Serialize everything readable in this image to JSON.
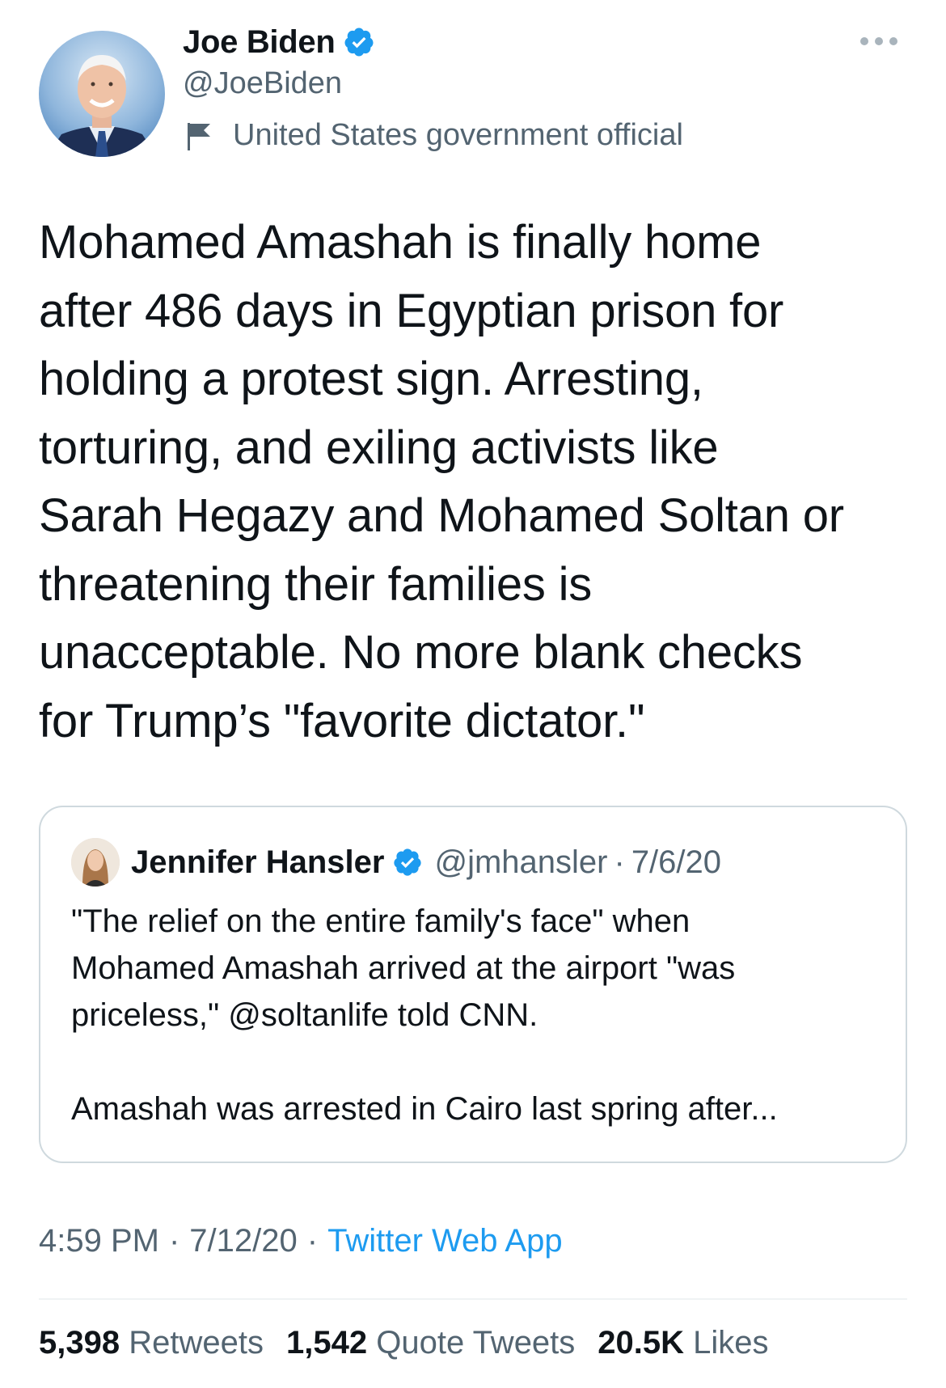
{
  "author": {
    "display_name": "Joe Biden",
    "handle": "@JoeBiden",
    "label": "United States government official",
    "verified": true
  },
  "tweet": {
    "text": "Mohamed Amashah is finally home\nafter 486 days in Egyptian prison for\nholding a protest sign. Arresting,\ntorturing, and exiling activists like\nSarah Hegazy and Mohamed Soltan or\nthreatening their families is\nunacceptable. No more blank checks\nfor Trump’s \"favorite dictator.\""
  },
  "quote": {
    "display_name": "Jennifer Hansler",
    "handle": "@jmhansler",
    "separator": "·",
    "date": "7/6/20",
    "verified": true,
    "text": "\"The relief on the entire family's face\" when\nMohamed Amashah arrived at the airport \"was\npriceless,\" @soltanlife told CNN.\n\nAmashah was arrested in Cairo last spring after..."
  },
  "meta": {
    "time": "4:59 PM",
    "separator": "·",
    "date": "7/12/20",
    "source": "Twitter Web App"
  },
  "stats": {
    "retweets_count": "5,398",
    "retweets_label": "Retweets",
    "quote_tweets_count": "1,542",
    "quote_tweets_label": "Quote Tweets",
    "likes_count": "20.5K",
    "likes_label": "Likes"
  },
  "colors": {
    "verified_blue": "#1d9bf0",
    "text_primary": "#0f1419",
    "text_secondary": "#536471",
    "border": "#cfd9de"
  },
  "icons": {
    "verified": "verified-badge-icon",
    "label": "flag-icon",
    "more": "more-horizontal-icon"
  }
}
